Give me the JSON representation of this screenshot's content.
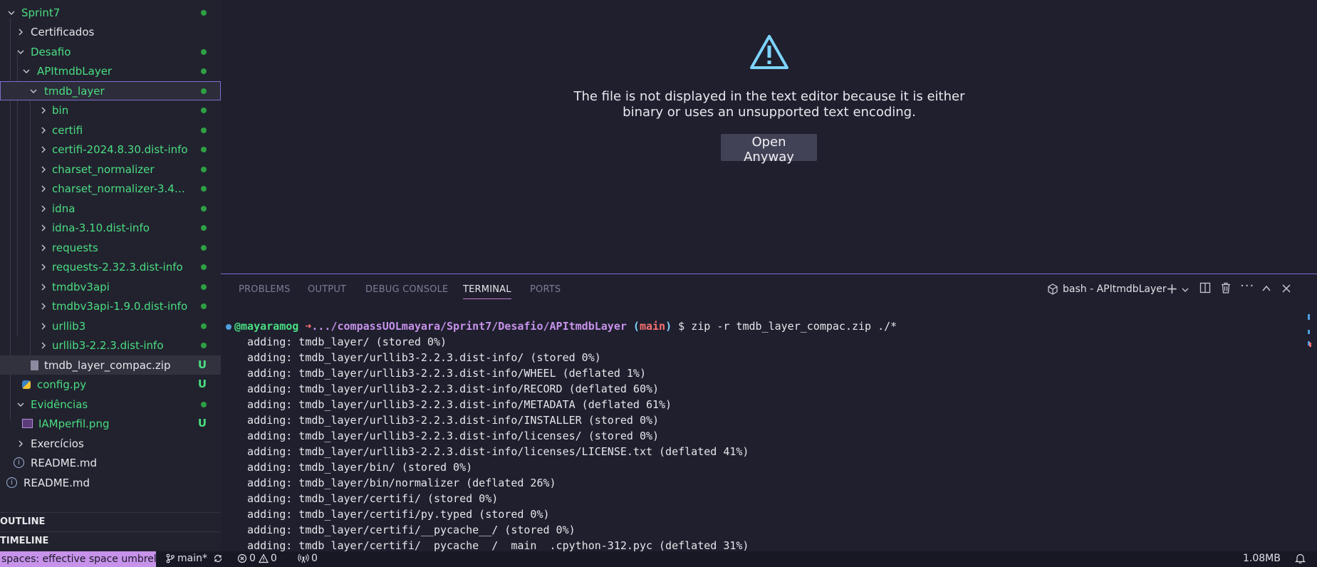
{
  "explorer": {
    "items": [
      {
        "label": "Sprint7",
        "status": "dot"
      },
      {
        "label": "Certificados",
        "status": ""
      },
      {
        "label": "Desafio",
        "status": "dot"
      },
      {
        "label": "APItmdbLayer",
        "status": "dot"
      },
      {
        "label": "tmdb_layer",
        "status": "dot"
      },
      {
        "label": "bin",
        "status": "dot"
      },
      {
        "label": "certifi",
        "status": "dot"
      },
      {
        "label": "certifi-2024.8.30.dist-info",
        "status": "dot"
      },
      {
        "label": "charset_normalizer",
        "status": "dot"
      },
      {
        "label": "charset_normalizer-3.4.0....",
        "status": "dot"
      },
      {
        "label": "idna",
        "status": "dot"
      },
      {
        "label": "idna-3.10.dist-info",
        "status": "dot"
      },
      {
        "label": "requests",
        "status": "dot"
      },
      {
        "label": "requests-2.32.3.dist-info",
        "status": "dot"
      },
      {
        "label": "tmdbv3api",
        "status": "dot"
      },
      {
        "label": "tmdbv3api-1.9.0.dist-info",
        "status": "dot"
      },
      {
        "label": "urllib3",
        "status": "dot"
      },
      {
        "label": "urllib3-2.2.3.dist-info",
        "status": "dot"
      },
      {
        "label": "tmdb_layer_compac.zip",
        "status": "U"
      },
      {
        "label": "config.py",
        "status": "U"
      },
      {
        "label": "Evidências",
        "status": "dot"
      },
      {
        "label": "IAMperfil.png",
        "status": "U"
      },
      {
        "label": "Exercícios",
        "status": ""
      },
      {
        "label": "README.md",
        "status": ""
      },
      {
        "label": "README.md",
        "status": ""
      }
    ],
    "outline_label": "OUTLINE",
    "timeline_label": "TIMELINE"
  },
  "editor": {
    "message": "The file is not displayed in the text editor because it is either binary or uses an unsupported text encoding.",
    "open_button": "Open Anyway"
  },
  "panel": {
    "tabs": [
      "PROBLEMS",
      "OUTPUT",
      "DEBUG CONSOLE",
      "TERMINAL",
      "PORTS"
    ],
    "active_tab": "TERMINAL",
    "terminal_name": "bash - APItmdbLayer"
  },
  "terminal": {
    "prompt_user": "@mayaramog",
    "prompt_arrow": "➜",
    "prompt_path": ".../compassUOLmayara/Sprint7/Desafio/APItmdbLayer",
    "prompt_branch_open": "(",
    "prompt_branch": "main",
    "prompt_branch_close": ")",
    "command": "$ zip -r tmdb_layer_compac.zip ./*",
    "lines": [
      "  adding: tmdb_layer/ (stored 0%)",
      "  adding: tmdb_layer/urllib3-2.2.3.dist-info/ (stored 0%)",
      "  adding: tmdb_layer/urllib3-2.2.3.dist-info/WHEEL (deflated 1%)",
      "  adding: tmdb_layer/urllib3-2.2.3.dist-info/RECORD (deflated 60%)",
      "  adding: tmdb_layer/urllib3-2.2.3.dist-info/METADATA (deflated 61%)",
      "  adding: tmdb_layer/urllib3-2.2.3.dist-info/INSTALLER (stored 0%)",
      "  adding: tmdb_layer/urllib3-2.2.3.dist-info/licenses/ (stored 0%)",
      "  adding: tmdb_layer/urllib3-2.2.3.dist-info/licenses/LICENSE.txt (deflated 41%)",
      "  adding: tmdb_layer/bin/ (stored 0%)",
      "  adding: tmdb_layer/bin/normalizer (deflated 26%)",
      "  adding: tmdb_layer/certifi/ (stored 0%)",
      "  adding: tmdb_layer/certifi/py.typed (stored 0%)",
      "  adding: tmdb_layer/certifi/__pycache__/ (stored 0%)",
      "  adding: tmdb_layer/certifi/__pycache__/__main__.cpython-312.pyc (deflated 31%)"
    ]
  },
  "statusbar": {
    "remote": "spaces: effective space umbrella",
    "branch": "main*",
    "errors": "0",
    "warnings": "0",
    "ports": "0",
    "size": "1.08MB"
  },
  "colors": {
    "accent": "#c792ea",
    "git_green": "#4ade80",
    "warning_icon": "#7dd3fc"
  }
}
